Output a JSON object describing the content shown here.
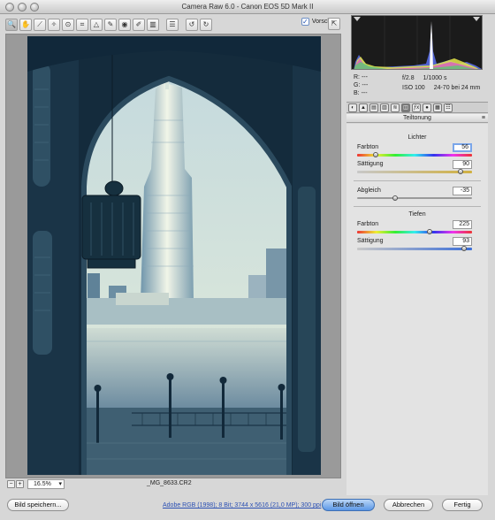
{
  "window": {
    "title": "Camera Raw 6.0 - Canon EOS 5D Mark II"
  },
  "toolbar": {
    "tools": [
      {
        "icon": "zoom-icon",
        "glyph": "🔍",
        "active": true
      },
      {
        "icon": "hand-icon",
        "glyph": "✋"
      },
      {
        "icon": "white-balance-icon",
        "glyph": "⟋"
      },
      {
        "icon": "color-sampler-icon",
        "glyph": "✧"
      },
      {
        "icon": "target-adjust-icon",
        "glyph": "⊙"
      },
      {
        "icon": "crop-icon",
        "glyph": "⌗"
      },
      {
        "icon": "straighten-icon",
        "glyph": "△"
      },
      {
        "icon": "spot-removal-icon",
        "glyph": "✎"
      },
      {
        "icon": "red-eye-icon",
        "glyph": "◉"
      },
      {
        "icon": "adjustment-brush-icon",
        "glyph": "✐"
      },
      {
        "icon": "graduated-filter-icon",
        "glyph": "▥"
      },
      {
        "icon": "preferences-icon",
        "glyph": "☰"
      },
      {
        "icon": "rotate-left-icon",
        "glyph": "↺"
      },
      {
        "icon": "rotate-right-icon",
        "glyph": "↻"
      }
    ],
    "preview_label": "Vorschau",
    "preview_checked": true
  },
  "status": {
    "zoom": "16.5%",
    "filename": "_MG_8633.CR2"
  },
  "readout": {
    "r": "R:",
    "g": "G:",
    "b": "B:",
    "dash": "---",
    "aperture": "f/2.8",
    "shutter": "1/1000 s",
    "iso": "ISO 100",
    "lens": "24-70 bei 24 mm"
  },
  "panel": {
    "header": "Teiltonung",
    "tabs": [
      "◐",
      "▲",
      "▤",
      "▥",
      "≋",
      "◫",
      "ƒx",
      "●",
      "▦",
      "☷"
    ],
    "highlights": {
      "title": "Lichter",
      "hue_label": "Farbton",
      "hue_value": "56",
      "hue_fraction": 0.16,
      "sat_label": "Sättigung",
      "sat_value": "90",
      "sat_fraction": 0.9
    },
    "balance": {
      "label": "Abgleich",
      "value": "-35",
      "fraction": 0.33
    },
    "shadows": {
      "title": "Tiefen",
      "hue_label": "Farbton",
      "hue_value": "225",
      "hue_fraction": 0.63,
      "sat_label": "Sättigung",
      "sat_value": "93",
      "sat_fraction": 0.93
    }
  },
  "footer": {
    "save_label": "Bild speichern...",
    "workflow_link": "Adobe RGB (1998); 8 Bit; 3744 x 5616 (21,0 MP); 300 ppi",
    "open_label": "Bild öffnen",
    "cancel_label": "Abbrechen",
    "done_label": "Fertig"
  }
}
